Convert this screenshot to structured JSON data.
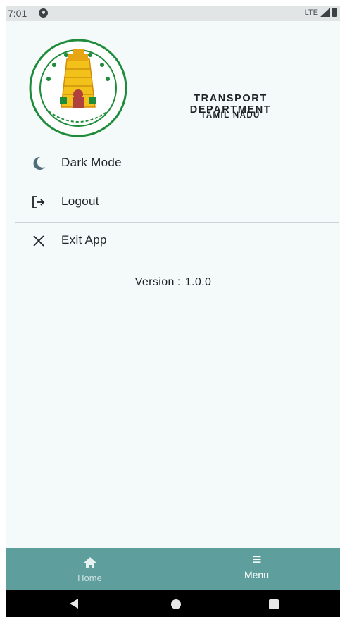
{
  "status_bar": {
    "time": "7:01",
    "network": "LTE"
  },
  "header": {
    "title": "TRANSPORT DEPARTMENT",
    "subtitle": "TAMIL NADU",
    "emblem_name": "tamil-nadu-emblem"
  },
  "menu": {
    "items": [
      {
        "label": "Dark Mode",
        "icon": "moon-icon"
      },
      {
        "label": "Logout",
        "icon": "logout-icon"
      },
      {
        "label": "Exit App",
        "icon": "close-icon"
      }
    ]
  },
  "version": {
    "label": "Version",
    "separator": ":",
    "value": "1.0.0"
  },
  "bottom_nav": {
    "items": [
      {
        "label": "Home",
        "icon": "home-icon",
        "active": false
      },
      {
        "label": "Menu",
        "icon": "menu-icon",
        "active": true
      }
    ]
  },
  "colors": {
    "background": "#f4f9fa",
    "bottom_nav": "#5e9f9d",
    "accent_icon": "#4f6d7a",
    "emblem_gold": "#f2c21a",
    "emblem_green": "#1e8c3a"
  }
}
